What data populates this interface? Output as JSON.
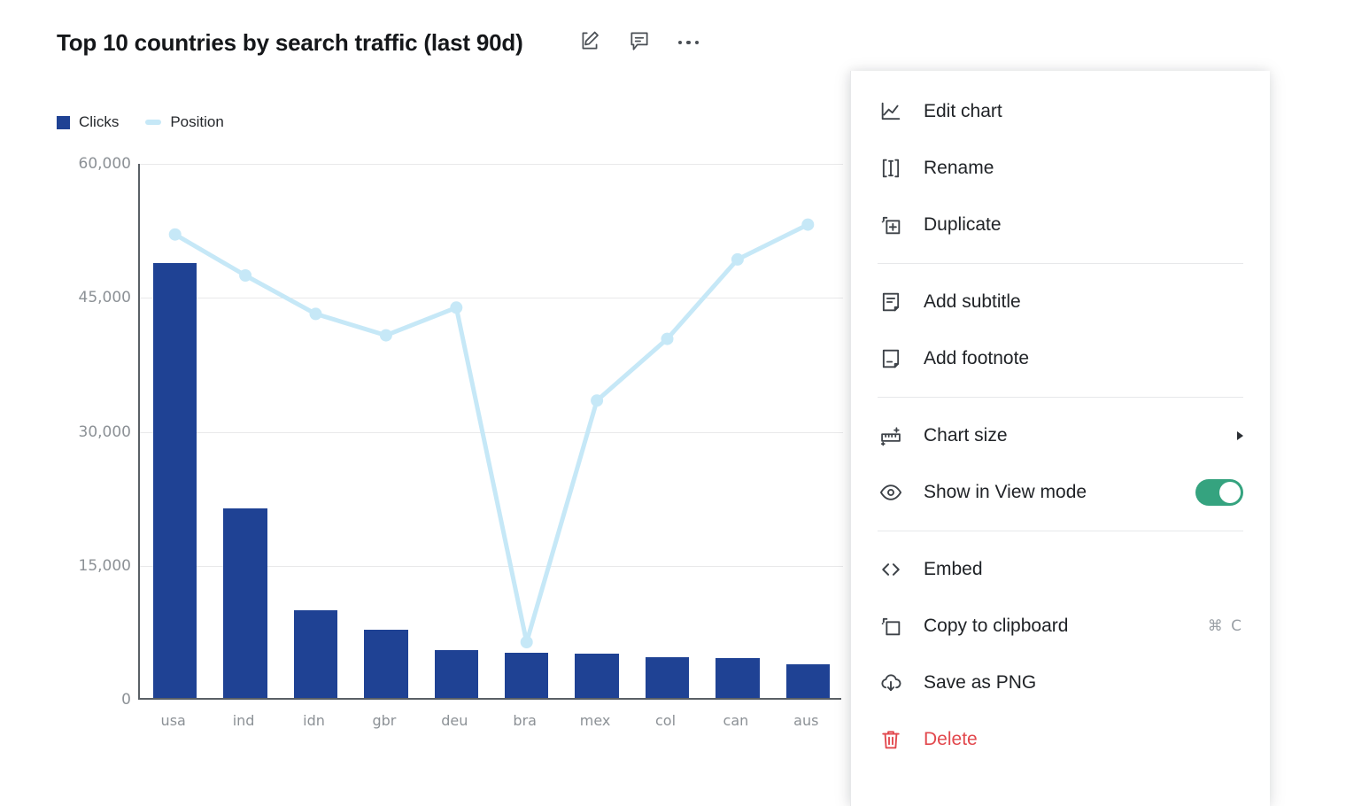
{
  "header": {
    "title": "Top 10 countries by search traffic (last 90d)",
    "edit_icon": "pencil-square-icon",
    "comment_icon": "comment-icon",
    "more_icon": "more-horizontal-icon"
  },
  "legend": [
    {
      "label": "Clicks",
      "color": "#1f4294",
      "marker": "square"
    },
    {
      "label": "Position",
      "color": "#c6e8f7",
      "marker": "line"
    }
  ],
  "chart_data": {
    "type": "bar",
    "title": "Top 10 countries by search traffic (last 90d)",
    "xlabel": "",
    "ylabel": "",
    "ylim": [
      0,
      60000
    ],
    "ytick_labels": [
      "0",
      "15,000",
      "30,000",
      "45,000",
      "60,000"
    ],
    "ytick_values": [
      0,
      15000,
      30000,
      45000,
      60000
    ],
    "grid": true,
    "legend_position": "top-left",
    "categories": [
      "usa",
      "ind",
      "idn",
      "gbr",
      "deu",
      "bra",
      "mex",
      "col",
      "can",
      "aus"
    ],
    "series": [
      {
        "name": "Clicks",
        "type": "bar",
        "color": "#1f4294",
        "values": [
          48700,
          21200,
          9800,
          7600,
          5400,
          5100,
          5000,
          4600,
          4500,
          3800
        ]
      },
      {
        "name": "Position",
        "type": "line",
        "color": "#c6e8f7",
        "values": [
          52100,
          47500,
          43200,
          40800,
          43900,
          6450,
          33500,
          40400,
          49300,
          53200
        ]
      }
    ]
  },
  "menu": {
    "items": [
      {
        "id": "edit-chart",
        "label": "Edit chart",
        "icon": "line-chart-icon",
        "shortcut": "",
        "type": "item"
      },
      {
        "id": "rename",
        "label": "Rename",
        "icon": "rename-text-icon",
        "shortcut": "",
        "type": "item"
      },
      {
        "id": "duplicate",
        "label": "Duplicate",
        "icon": "duplicate-icon",
        "shortcut": "",
        "type": "item"
      },
      {
        "id": "sep-1",
        "type": "separator"
      },
      {
        "id": "add-subtitle",
        "label": "Add subtitle",
        "icon": "subtitle-note-icon",
        "shortcut": "",
        "type": "item"
      },
      {
        "id": "add-footnote",
        "label": "Add footnote",
        "icon": "footnote-note-icon",
        "shortcut": "",
        "type": "item"
      },
      {
        "id": "sep-2",
        "type": "separator"
      },
      {
        "id": "chart-size",
        "label": "Chart size",
        "icon": "ruler-icon",
        "shortcut": "",
        "type": "submenu"
      },
      {
        "id": "show-in-view-mode",
        "label": "Show in View mode",
        "icon": "eye-icon",
        "shortcut": "",
        "type": "toggle",
        "toggle_on": true,
        "toggle_color": "#35a37f"
      },
      {
        "id": "sep-3",
        "type": "separator"
      },
      {
        "id": "embed",
        "label": "Embed",
        "icon": "code-brackets-icon",
        "shortcut": "",
        "type": "item"
      },
      {
        "id": "copy-to-clipboard",
        "label": "Copy to clipboard",
        "icon": "copy-icon",
        "shortcut": "⌘ C",
        "type": "item"
      },
      {
        "id": "save-as-png",
        "label": "Save as PNG",
        "icon": "cloud-download-icon",
        "shortcut": "",
        "type": "item"
      },
      {
        "id": "delete",
        "label": "Delete",
        "icon": "trash-icon",
        "shortcut": "",
        "type": "item",
        "danger": true
      }
    ]
  }
}
